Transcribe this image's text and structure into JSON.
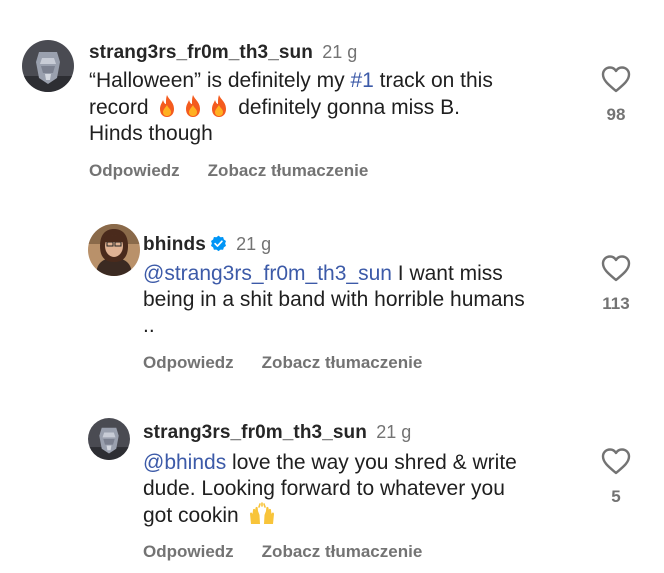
{
  "comments": [
    {
      "username": "strang3rs_fr0m_th3_sun",
      "time": "21 g",
      "lines": [
        {
          "pre": "“Halloween” is definitely my ",
          "mention": "#1",
          "post": " track on this"
        },
        {
          "pre": "record ",
          "post": " definitely gonna miss B."
        },
        {
          "pre": "Hinds though"
        }
      ],
      "reply_label": "Odpowiedz",
      "translate_label": "Zobacz tłumaczenie",
      "likes": "98"
    },
    {
      "username": "bhinds",
      "time": "21 g",
      "lines": [
        {
          "mention": "@strang3rs_fr0m_th3_sun",
          "post": " I want miss"
        },
        {
          "pre": "being in a shit band with horrible humans"
        },
        {
          "pre": ".."
        }
      ],
      "reply_label": "Odpowiedz",
      "translate_label": "Zobacz tłumaczenie",
      "likes": "113"
    },
    {
      "username": "strang3rs_fr0m_th3_sun",
      "time": "21 g",
      "lines": [
        {
          "mention": "@bhinds",
          "post": " love the way you shred & write"
        },
        {
          "pre": "dude. Looking forward to whatever you"
        },
        {
          "pre": "got cookin "
        }
      ],
      "reply_label": "Odpowiedz",
      "translate_label": "Zobacz tłumaczenie",
      "likes": "5"
    }
  ],
  "icons": {
    "like": "heart-outline-icon",
    "verified": "verified-badge-icon",
    "fire": "fire-emoji",
    "raised_hands": "raised-hands-emoji"
  },
  "colors": {
    "mention": "#3c5aa8",
    "verified": "#0095f6",
    "secondary_text": "#737373"
  }
}
